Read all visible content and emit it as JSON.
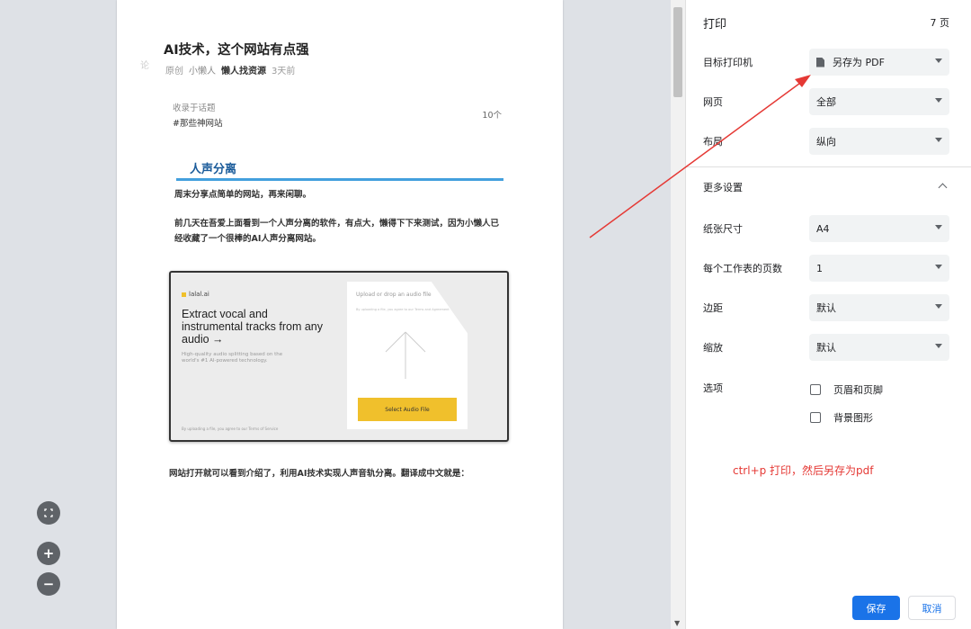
{
  "article": {
    "title": "AI技术，这个网站有点强",
    "tag": "原创",
    "author": "小懒人",
    "site": "懒人找资源",
    "time": "3天前",
    "side_glyph": "论",
    "topic_label": "收录于话题",
    "topic_name": "#那些神网站",
    "topic_count": "10个",
    "section_heading": "人声分离",
    "para1": "周末分享点简单的网站，再来闲聊。",
    "para2": "前几天在吾爱上面看到一个人声分离的软件，有点大，懒得下下来测试，因为小懒人已经收藏了一个很棒的AI人声分离网站。",
    "para3": "网站打开就可以看到介绍了，利用AI技术实现人声音轨分离。翻译成中文就是："
  },
  "embed": {
    "brand": "lalal.ai",
    "headline": "Extract vocal and instrumental tracks from any audio →",
    "sub": "High-quality audio splitting based on the world's #1 AI-powered technology.",
    "upload": "Upload or drop an audio file",
    "upload_small": "By uploading a file, you agree to our Terms and Agreement",
    "button": "Select Audio File",
    "foot": "By uploading a file, you agree to our Terms of Service"
  },
  "panel": {
    "title": "打印",
    "pages": "7 页",
    "destination_label": "目标打印机",
    "destination_value": "另存为 PDF",
    "pages_label": "网页",
    "pages_value": "全部",
    "layout_label": "布局",
    "layout_value": "纵向",
    "more_settings": "更多设置",
    "paper_label": "纸张尺寸",
    "paper_value": "A4",
    "persheet_label": "每个工作表的页数",
    "persheet_value": "1",
    "margins_label": "边距",
    "margins_value": "默认",
    "scale_label": "缩放",
    "scale_value": "默认",
    "options_label": "选项",
    "opt_headers": "页眉和页脚",
    "opt_background": "背景图形",
    "annotation": "ctrl+p 打印，然后另存为pdf",
    "save": "保存",
    "cancel": "取消"
  },
  "colors": {
    "accent": "#1a73e8",
    "annotation": "#e53935",
    "heading_bar": "#43a0dd"
  }
}
